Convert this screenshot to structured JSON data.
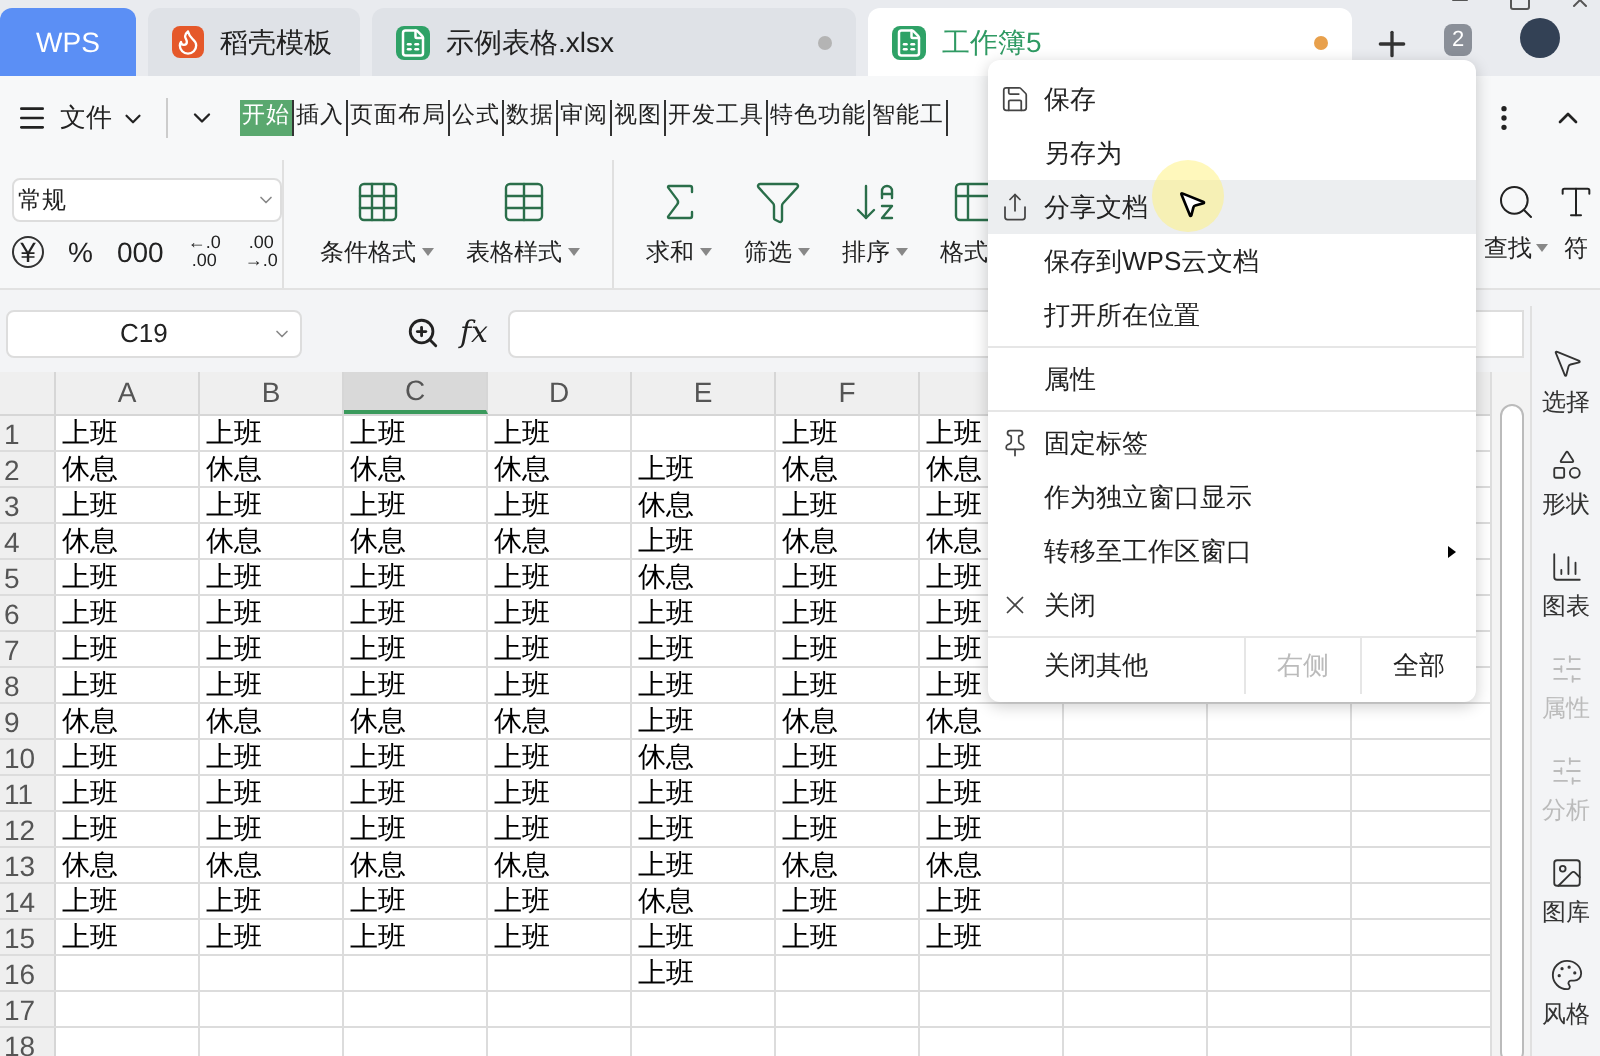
{
  "tabs": [
    {
      "label": "WPS",
      "kind": "home",
      "selected": false
    },
    {
      "label": "稻壳模板",
      "kind": "docer",
      "selected": false
    },
    {
      "label": "示例表格.xlsx",
      "kind": "sheet",
      "selected": false,
      "color": "#b4b4b4"
    },
    {
      "label": "工作簿5",
      "kind": "sheet",
      "selected": true,
      "color": "#e8a04c"
    }
  ],
  "window_count": "2",
  "menu_bar": {
    "file": "文件",
    "items": [
      {
        "label": "开始",
        "selected": true
      },
      {
        "label": "插入",
        "selected": false
      },
      {
        "label": "页面布局",
        "selected": false
      },
      {
        "label": "公式",
        "selected": false
      },
      {
        "label": "数据",
        "selected": false
      },
      {
        "label": "审阅",
        "selected": false
      },
      {
        "label": "视图",
        "selected": false
      },
      {
        "label": "开发工具",
        "selected": false
      },
      {
        "label": "特色功能",
        "selected": false
      },
      {
        "label": "智能工",
        "selected": false
      }
    ]
  },
  "ribbon": {
    "number_format": "常规",
    "format_buttons": [
      {
        "kind": "currency",
        "lines": [
          "¥"
        ]
      },
      {
        "kind": "text",
        "lines": [
          "%"
        ]
      },
      {
        "kind": "text",
        "lines": [
          "000"
        ]
      },
      {
        "kind": "text",
        "lines": [
          "←.0",
          ".00"
        ]
      },
      {
        "kind": "text",
        "lines": [
          ".00",
          "→.0"
        ]
      }
    ],
    "tools": [
      {
        "label": "条件格式",
        "kind": "conditional"
      },
      {
        "label": "表格样式",
        "kind": "table-style"
      },
      {
        "label": "求和",
        "kind": "sum"
      },
      {
        "label": "筛选",
        "kind": "filter"
      },
      {
        "label": "排序",
        "kind": "sort"
      },
      {
        "label": "格式",
        "kind": "format"
      }
    ],
    "right_tools": [
      {
        "label": "查找",
        "kind": "search"
      },
      {
        "label": "符",
        "kind": "symbol"
      }
    ]
  },
  "formula_bar": {
    "cell": "C19",
    "fx": "fx"
  },
  "sheet": {
    "columns": [
      {
        "label": "A",
        "selected": false
      },
      {
        "label": "B",
        "selected": false
      },
      {
        "label": "C",
        "selected": true
      },
      {
        "label": "D",
        "selected": false
      },
      {
        "label": "E",
        "selected": false
      },
      {
        "label": "F",
        "selected": false
      }
    ],
    "rows": [
      {
        "number": "1",
        "cells": [
          "上班",
          "上班",
          "上班",
          "上班",
          null,
          "上班",
          "上班"
        ]
      },
      {
        "number": "2",
        "cells": [
          "休息",
          "休息",
          "休息",
          "休息",
          "上班",
          "休息",
          "休息"
        ]
      },
      {
        "number": "3",
        "cells": [
          "上班",
          "上班",
          "上班",
          "上班",
          "休息",
          "上班",
          "上班"
        ]
      },
      {
        "number": "4",
        "cells": [
          "休息",
          "休息",
          "休息",
          "休息",
          "上班",
          "休息",
          "休息"
        ]
      },
      {
        "number": "5",
        "cells": [
          "上班",
          "上班",
          "上班",
          "上班",
          "休息",
          "上班",
          "上班"
        ]
      },
      {
        "number": "6",
        "cells": [
          "上班",
          "上班",
          "上班",
          "上班",
          "上班",
          "上班",
          "上班"
        ]
      },
      {
        "number": "7",
        "cells": [
          "上班",
          "上班",
          "上班",
          "上班",
          "上班",
          "上班",
          "上班"
        ]
      },
      {
        "number": "8",
        "cells": [
          "上班",
          "上班",
          "上班",
          "上班",
          "上班",
          "上班",
          "上班"
        ]
      },
      {
        "number": "9",
        "cells": [
          "休息",
          "休息",
          "休息",
          "休息",
          "上班",
          "休息",
          "休息"
        ]
      },
      {
        "number": "10",
        "cells": [
          "上班",
          "上班",
          "上班",
          "上班",
          "休息",
          "上班",
          "上班"
        ]
      },
      {
        "number": "11",
        "cells": [
          "上班",
          "上班",
          "上班",
          "上班",
          "上班",
          "上班",
          "上班"
        ]
      },
      {
        "number": "12",
        "cells": [
          "上班",
          "上班",
          "上班",
          "上班",
          "上班",
          "上班",
          "上班"
        ]
      },
      {
        "number": "13",
        "cells": [
          "休息",
          "休息",
          "休息",
          "休息",
          "上班",
          "休息",
          "休息"
        ]
      },
      {
        "number": "14",
        "cells": [
          "上班",
          "上班",
          "上班",
          "上班",
          "休息",
          "上班",
          "上班"
        ]
      },
      {
        "number": "15",
        "cells": [
          "上班",
          "上班",
          "上班",
          "上班",
          "上班",
          "上班",
          "上班"
        ]
      },
      {
        "number": "16",
        "cells": [
          null,
          null,
          null,
          null,
          "上班",
          null,
          null
        ]
      },
      {
        "number": "17",
        "cells": []
      },
      {
        "number": "18",
        "cells": []
      }
    ]
  },
  "side_panel": [
    {
      "label": "选择",
      "kind": "select",
      "disabled": false
    },
    {
      "label": "形状",
      "kind": "shape",
      "disabled": false
    },
    {
      "label": "图表",
      "kind": "chart",
      "disabled": false
    },
    {
      "label": "属性",
      "kind": "props",
      "disabled": true
    },
    {
      "label": "分析",
      "kind": "analyze",
      "disabled": true
    },
    {
      "label": "图库",
      "kind": "gallery",
      "disabled": false
    },
    {
      "label": "风格",
      "kind": "style",
      "disabled": false
    }
  ],
  "context_menu": {
    "groups": [
      [
        {
          "label": "保存",
          "kind": "save",
          "highlighted": false
        },
        {
          "label": "另存为",
          "kind": "plain",
          "highlighted": false
        },
        {
          "label": "分享文档",
          "kind": "share",
          "highlighted": true
        },
        {
          "label": "保存到WPS云文档",
          "kind": "plain",
          "highlighted": false
        },
        {
          "label": "打开所在位置",
          "kind": "plain",
          "highlighted": false
        }
      ],
      [
        {
          "label": "属性",
          "kind": "plain",
          "highlighted": false
        }
      ],
      [
        {
          "label": "固定标签",
          "kind": "pin",
          "highlighted": false
        },
        {
          "label": "作为独立窗口显示",
          "kind": "plain",
          "highlighted": false
        },
        {
          "label": "转移至工作区窗口",
          "kind": "submenu",
          "highlighted": false
        },
        {
          "label": "关闭",
          "kind": "close",
          "highlighted": false
        }
      ]
    ],
    "footer": [
      {
        "label": "关闭其他",
        "disabled": false
      },
      {
        "label": "右侧",
        "disabled": true
      },
      {
        "label": "全部",
        "disabled": false
      }
    ]
  }
}
